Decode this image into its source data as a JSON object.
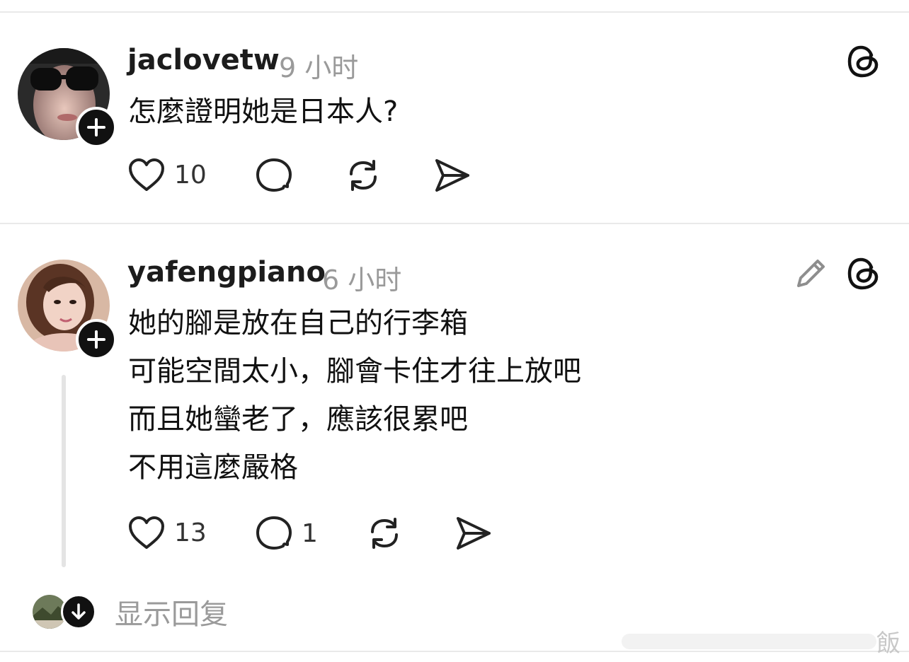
{
  "posts": [
    {
      "username": "jaclovetw",
      "time": "9 小时",
      "body": "怎麼證明她是日本人?",
      "likes": "10",
      "replies": ""
    },
    {
      "username": "yafengpiano",
      "time": "6 小时",
      "body": "她的腳是放在自己的行李箱\n可能空間太小，腳會卡住才往上放吧\n而且她蠻老了，應該很累吧\n不用這麼嚴格",
      "likes": "13",
      "replies": "1"
    }
  ],
  "show_replies_label": "显示回复",
  "watermark_text": "飯",
  "icons": {
    "like": "heart-icon",
    "comment": "comment-bubble-icon",
    "repost": "repost-icon",
    "share": "send-icon",
    "threads": "threads-logo-icon",
    "edit": "pencil-icon",
    "follow": "plus-icon",
    "expand": "arrow-down-icon"
  },
  "colors": {
    "text": "#111111",
    "muted": "#9a9a9a",
    "divider": "#e9e9e9"
  }
}
